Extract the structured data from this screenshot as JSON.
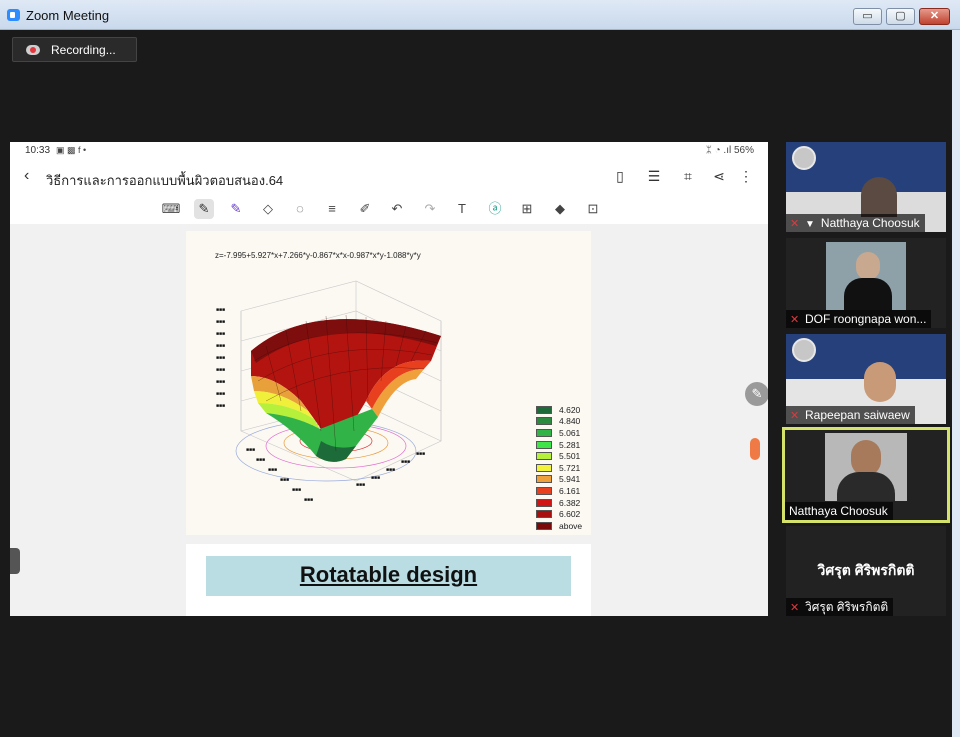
{
  "window": {
    "title": "Zoom Meeting",
    "minimize_label": "▭",
    "maximize_label": "▢",
    "close_label": "✕"
  },
  "recording": {
    "label": "Recording..."
  },
  "shared_screen": {
    "status_bar": {
      "time": "10:33",
      "left_icons": "▣ ▩ f •",
      "right_status": "ᛯ ◔ .ıl 56%"
    },
    "doc_title": "วิธีการและการออกแบบพื้นผิวตอบสนอง.64",
    "toolbar_tools": [
      "keyboard-icon",
      "pen-icon",
      "highlighter-icon",
      "eraser-icon",
      "lasso-icon",
      "text-format-icon",
      "pen-settings-icon",
      "undo-icon",
      "redo-icon",
      "text-box-icon",
      "shape-icon",
      "image-icon",
      "more-tools-icon",
      "lock-icon"
    ],
    "page1": {
      "equation": "z=-7.995+5.927*x+7.266*y-0.867*x*x-0.987*x*y-1.088*y*y",
      "legend": [
        {
          "label": "4.620",
          "color": "#1e6b3a"
        },
        {
          "label": "4.840",
          "color": "#2c8a3f"
        },
        {
          "label": "5.061",
          "color": "#31b348"
        },
        {
          "label": "5.281",
          "color": "#3fe34a"
        },
        {
          "label": "5.501",
          "color": "#b6f03a"
        },
        {
          "label": "5.721",
          "color": "#f2f23a"
        },
        {
          "label": "5.941",
          "color": "#f0a03a"
        },
        {
          "label": "6.161",
          "color": "#e8401f"
        },
        {
          "label": "6.382",
          "color": "#d11515"
        },
        {
          "label": "6.602",
          "color": "#a80f0f"
        },
        {
          "label": "above",
          "color": "#7a0a0a"
        }
      ]
    },
    "page2": {
      "heading": "Rotatable design"
    }
  },
  "participants": [
    {
      "name": "Natthaya Choosuk",
      "muted": true,
      "pinned": true
    },
    {
      "name": "DOF roongnapa won...",
      "muted": true,
      "pinned": false
    },
    {
      "name": "Rapeepan saiwaew",
      "muted": true,
      "pinned": false
    },
    {
      "name": "Natthaya Choosuk",
      "muted": false,
      "pinned": false,
      "active_speaker": true
    },
    {
      "name": "วิศรุต ศิริพรกิตติ",
      "muted": true,
      "pinned": false,
      "display_name_big": "วิศรุต ศิริพรกิตติ"
    }
  ]
}
